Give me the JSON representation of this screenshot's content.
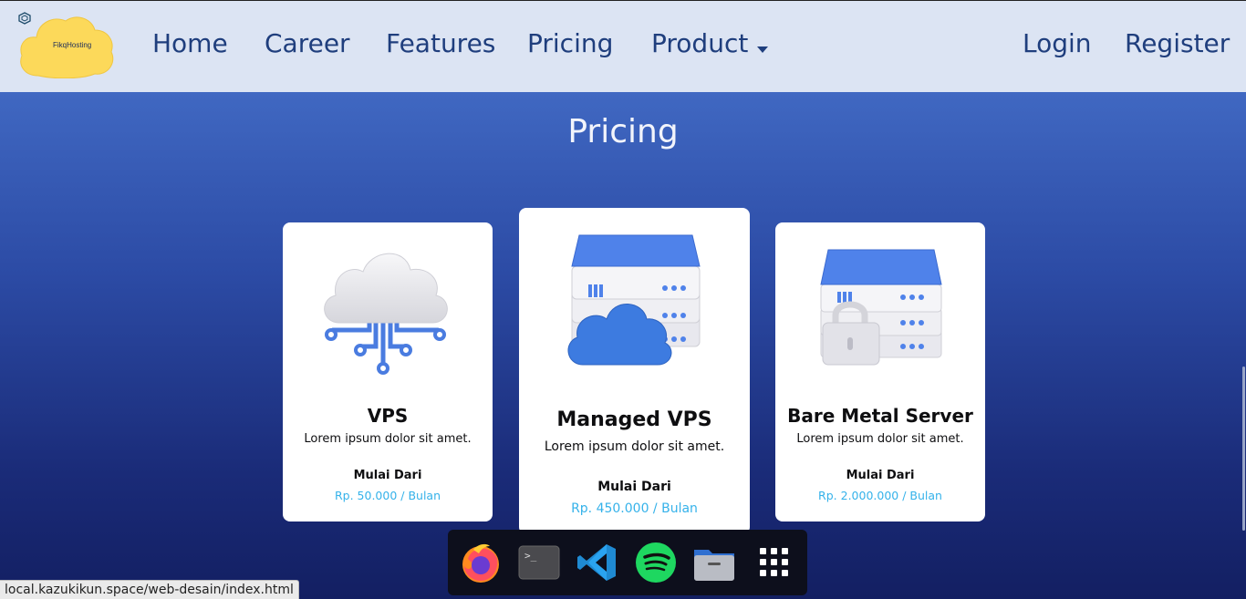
{
  "brand": {
    "name": "FikqHosting",
    "accent": "#fcd95a"
  },
  "nav": {
    "links": [
      "Home",
      "Career",
      "Features",
      "Pricing",
      "Product"
    ],
    "auth": [
      "Login",
      "Register"
    ],
    "text_color": "#1f3e7d",
    "bg": "#dce4f3"
  },
  "section": {
    "title": "Pricing"
  },
  "cards": [
    {
      "title": "VPS",
      "desc": "Lorem ipsum dolor sit amet.",
      "from": "Mulai Dari",
      "price": "Rp. 50.000 / Bulan",
      "icon": "cloud-network-icon"
    },
    {
      "title": "Managed VPS",
      "desc": "Lorem ipsum dolor sit amet.",
      "from": "Mulai Dari",
      "price": "Rp. 450.000 / Bulan",
      "icon": "server-cloud-icon"
    },
    {
      "title": "Bare Metal Server",
      "desc": "Lorem ipsum dolor sit amet.",
      "from": "Mulai Dari",
      "price": "Rp. 2.000.000 / Bulan",
      "icon": "server-lock-icon"
    }
  ],
  "price_color": "#35b2ea",
  "dock": {
    "apps": [
      "firefox-icon",
      "terminal-icon",
      "vscode-icon",
      "spotify-icon",
      "files-icon",
      "app-grid-icon"
    ],
    "terminal_glyph": ">_"
  },
  "status_url": "local.kazukikun.space/web-desain/index.html"
}
